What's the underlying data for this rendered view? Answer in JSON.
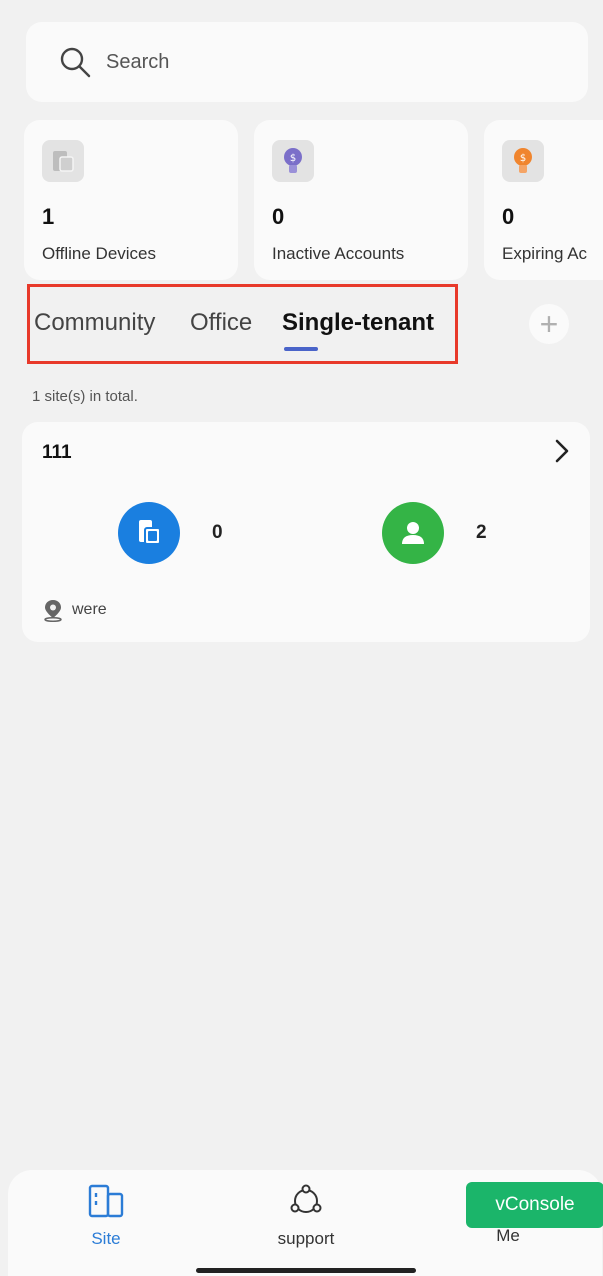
{
  "search": {
    "placeholder": "Search"
  },
  "stats": [
    {
      "value": "1",
      "label": "Offline Devices",
      "icon": "device-icon"
    },
    {
      "value": "0",
      "label": "Inactive Accounts",
      "icon": "inactive-account-icon",
      "color": "#7b6fc9"
    },
    {
      "value": "0",
      "label": "Expiring Ac",
      "icon": "expiring-account-icon",
      "color": "#f0852e"
    }
  ],
  "tabs": [
    {
      "label": "Community"
    },
    {
      "label": "Office"
    },
    {
      "label": "Single-tenant",
      "active": true
    }
  ],
  "add_label": "+",
  "total_text": "1 site(s) in total.",
  "site": {
    "name": "111",
    "devices": "0",
    "users": "2",
    "location": "were"
  },
  "nav": {
    "site": "Site",
    "support": "support",
    "me": "Me"
  },
  "vconsole": "vConsole",
  "colors": {
    "accent": "#2b7cd6",
    "highlight_border": "#e8392a",
    "device_blue": "#1a7fe0",
    "user_green": "#34b446",
    "vconsole_green": "#1bb56a"
  }
}
